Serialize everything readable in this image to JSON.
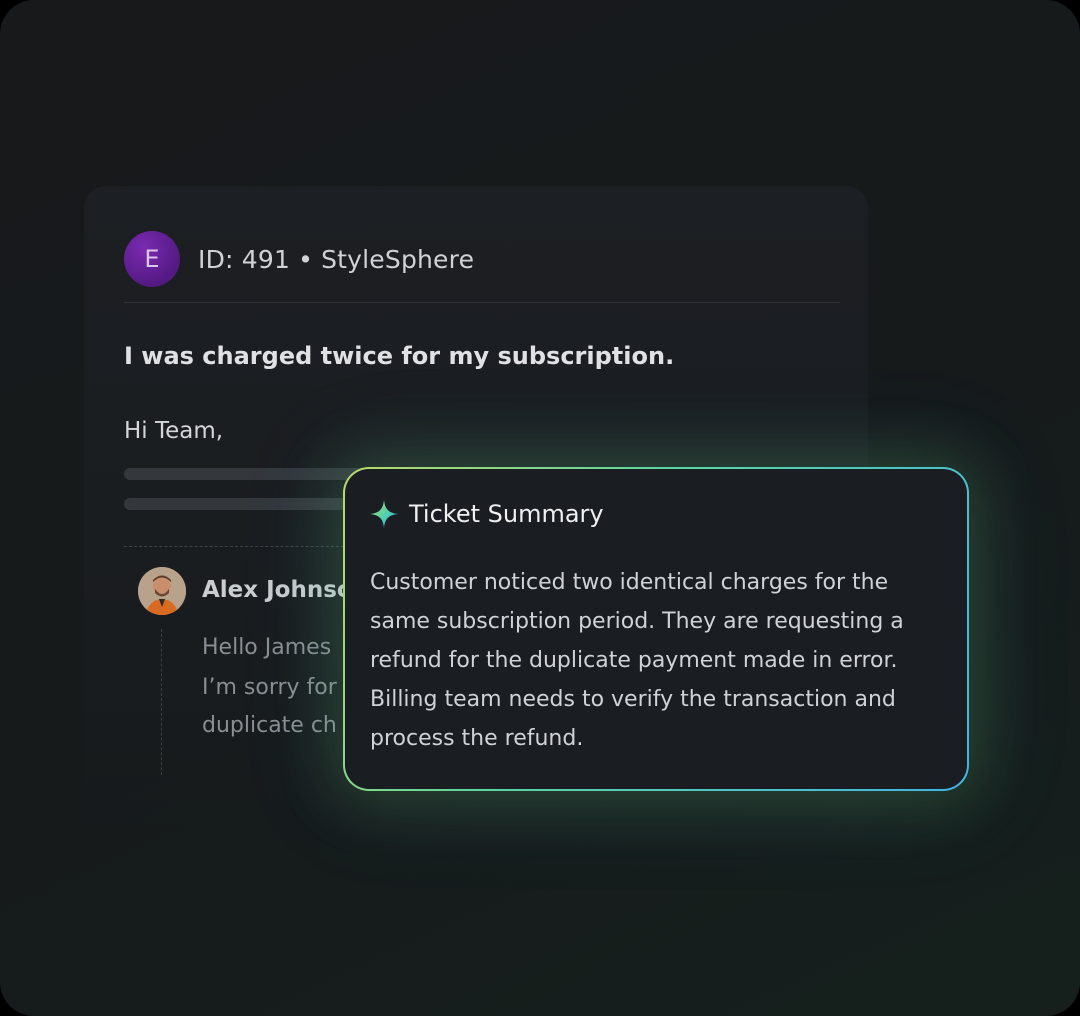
{
  "ticket": {
    "avatar_letter": "E",
    "id_label": "ID: 491",
    "separator": "•",
    "company": "StyleSphere",
    "subject": "I was charged twice for my subscription.",
    "greeting": "Hi Team,"
  },
  "reply": {
    "author": "Alex Johnso",
    "lines": [
      "Hello James",
      "I’m sorry for",
      "duplicate ch"
    ]
  },
  "summary": {
    "title": "Ticket Summary",
    "icon": "sparkle-icon",
    "lines": [
      "Customer noticed two identical charges for the",
      "same subscription period. They are requesting a",
      "refund for the duplicate payment made in error.",
      "Billing team needs to verify the transaction and",
      "process the refund."
    ]
  },
  "colors": {
    "avatar_purple": "#5a1b8c",
    "summary_border_start": "#b9d96a",
    "summary_border_end": "#3fb4e6"
  }
}
